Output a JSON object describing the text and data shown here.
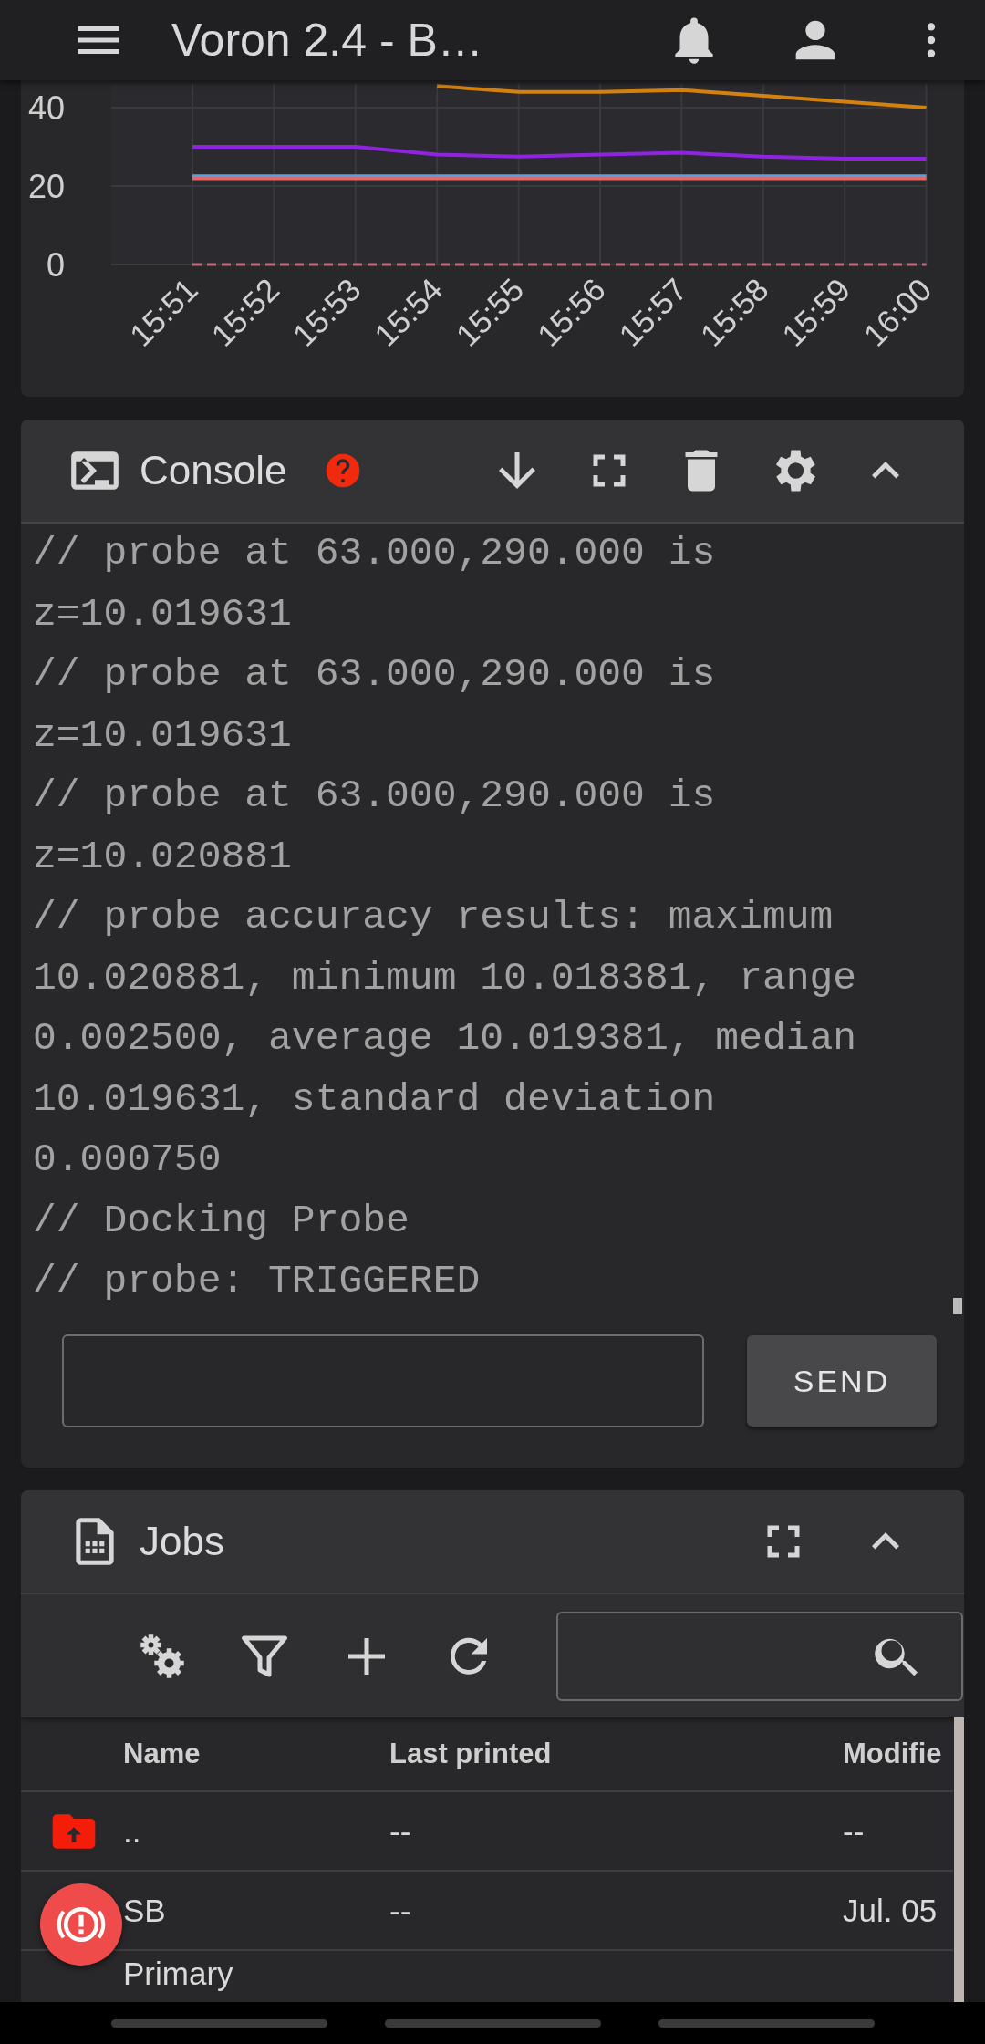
{
  "app_bar": {
    "title": "Voron 2.4 - B…"
  },
  "temperature_chart": {
    "chart_data": {
      "type": "line",
      "categories": [
        "15:51",
        "15:52",
        "15:53",
        "15:54",
        "15:55",
        "15:56",
        "15:57",
        "15:58",
        "15:59",
        "16:00"
      ],
      "yticks": [
        0,
        20,
        40
      ],
      "ylim": [
        0,
        46
      ],
      "series": [
        {
          "color": "#d4820f",
          "values": [
            null,
            null,
            null,
            45.5,
            44,
            44,
            44.5,
            43,
            41.5,
            40
          ]
        },
        {
          "color": "#8e24e0",
          "values": [
            30,
            30,
            30,
            28,
            27.5,
            28,
            28.5,
            27.5,
            27,
            27
          ]
        },
        {
          "color": "#5aa0e0",
          "values": [
            22.5,
            22.5,
            22.5,
            22.5,
            22.5,
            22.5,
            22.5,
            22.5,
            22.5,
            22.5
          ]
        },
        {
          "color": "#e06a6a",
          "values": [
            22,
            22,
            22,
            22,
            22,
            22,
            22,
            22,
            22,
            22
          ]
        },
        {
          "color": "#c96a80",
          "line_style": "dashed",
          "values": [
            0,
            0,
            0,
            0,
            0,
            0,
            0,
            0,
            0,
            0
          ]
        }
      ]
    }
  },
  "console": {
    "title": "Console",
    "lines": [
      "// probe at 63.000,290.000 is",
      "z=10.019631",
      "// probe at 63.000,290.000 is",
      "z=10.019631",
      "// probe at 63.000,290.000 is",
      "z=10.020881",
      "// probe accuracy results: maximum",
      "10.020881, minimum 10.018381, range",
      "0.002500, average 10.019381, median",
      "10.019631, standard deviation",
      "0.000750",
      "// Docking Probe",
      "// probe: TRIGGERED"
    ],
    "send_button": "SEND"
  },
  "jobs": {
    "title": "Jobs",
    "columns": [
      "Name",
      "Last printed",
      "Modifie"
    ],
    "rows": [
      {
        "kind": "parent-folder",
        "name": "..",
        "last_printed": "--",
        "modified": "--"
      },
      {
        "kind": "file",
        "name": "SB",
        "last_printed": "--",
        "modified": "Jul. 05"
      },
      {
        "kind": "file",
        "name": "Primary"
      }
    ]
  }
}
